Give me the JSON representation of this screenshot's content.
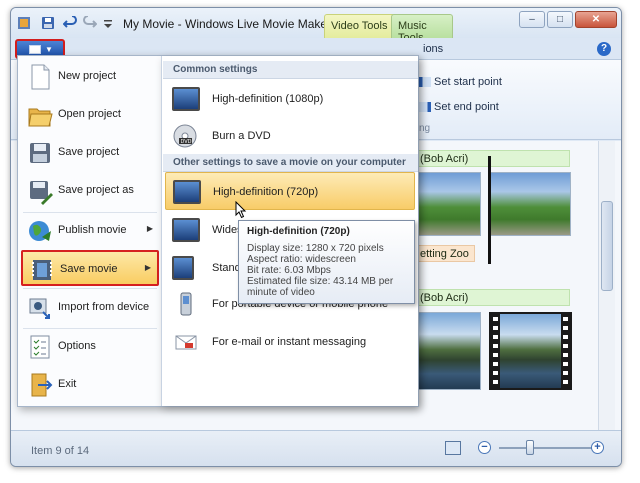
{
  "window": {
    "title": "My Movie - Windows Live Movie Maker",
    "context_tabs": [
      "Video Tools",
      "Music Tools"
    ],
    "tab_partial": "ions",
    "controls": {
      "minimize": "–",
      "maximize": "□",
      "close": "✕"
    },
    "help": "?"
  },
  "ribbon": {
    "set_start": "Set start point",
    "set_end": "Set end point",
    "group_label": "ng"
  },
  "storyboard": {
    "chip1": "(Bob Acri)",
    "chip2": "etting Zoo",
    "chip3": "(Bob Acri)"
  },
  "status": {
    "item_text": "Item 9 of 14",
    "zoom_level": 0.33
  },
  "app_menu": {
    "items": [
      {
        "label": "New project"
      },
      {
        "label": "Open project"
      },
      {
        "label": "Save project"
      },
      {
        "label": "Save project as"
      },
      {
        "label": "Publish movie"
      },
      {
        "label": "Save movie"
      },
      {
        "label": "Import from device"
      },
      {
        "label": "Options"
      },
      {
        "label": "Exit"
      }
    ],
    "submenu": {
      "header1": "Common settings",
      "header2": "Other settings to save a movie on your computer",
      "items": [
        {
          "label": "High-definition (1080p)"
        },
        {
          "label": "Burn a DVD"
        },
        {
          "label": "High-definition (720p)"
        },
        {
          "label": "Wides"
        },
        {
          "label": "Stand"
        },
        {
          "label": "For portable device or mobile phone"
        },
        {
          "label": "For e-mail or instant messaging"
        }
      ],
      "dvd_badge": "DVD"
    },
    "tooltip": {
      "title": "High-definition (720p)",
      "lines": [
        "Display size: 1280 x 720 pixels",
        "Aspect ratio: widescreen",
        "Bit rate: 6.03 Mbps",
        "Estimated file size: 43.14 MB per minute of video"
      ]
    }
  },
  "colors": {
    "highlight": "#f9cd62",
    "annotation_red": "#d62020",
    "app_button_blue": "#1c4fa8"
  }
}
